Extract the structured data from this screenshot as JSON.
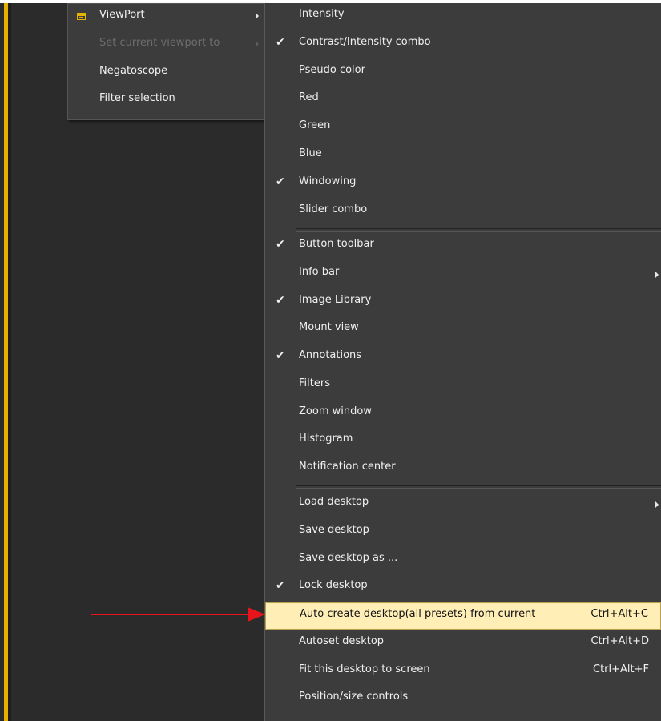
{
  "main_menu": {
    "items": [
      {
        "label": "ViewPort",
        "icon": "viewport-icon",
        "has_submenu": true,
        "disabled": false
      },
      {
        "label": "Set current viewport to",
        "has_submenu": true,
        "disabled": true
      },
      {
        "label": "Negatoscope",
        "disabled": false
      },
      {
        "label": "Filter selection",
        "disabled": false
      }
    ]
  },
  "submenu": {
    "items": [
      {
        "label": "Intensity",
        "checked": false
      },
      {
        "label": "Contrast/Intensity combo",
        "checked": true
      },
      {
        "label": "Pseudo color",
        "checked": false
      },
      {
        "label": "Red",
        "checked": false
      },
      {
        "label": "Green",
        "checked": false
      },
      {
        "label": "Blue",
        "checked": false
      },
      {
        "label": "Windowing",
        "checked": true
      },
      {
        "label": "Slider combo",
        "checked": false
      },
      {
        "label": "Button toolbar",
        "checked": true
      },
      {
        "label": "Info bar",
        "checked": false,
        "has_submenu": true
      },
      {
        "label": "Image Library",
        "checked": true
      },
      {
        "label": "Mount view",
        "checked": false
      },
      {
        "label": "Annotations",
        "checked": true
      },
      {
        "label": "Filters",
        "checked": false
      },
      {
        "label": "Zoom window",
        "checked": false
      },
      {
        "label": "Histogram",
        "checked": false
      },
      {
        "label": "Notification center",
        "checked": false
      },
      {
        "label": "Load desktop",
        "checked": false,
        "has_submenu": true
      },
      {
        "label": "Save desktop",
        "checked": false
      },
      {
        "label": "Save desktop as ...",
        "checked": false
      },
      {
        "label": "Lock desktop",
        "checked": true
      },
      {
        "label": "Auto create desktop(all presets) from current",
        "shortcut": "Ctrl+Alt+C",
        "highlighted": true
      },
      {
        "label": "Autoset desktop",
        "shortcut": "Ctrl+Alt+D"
      },
      {
        "label": "Fit this desktop to screen",
        "shortcut": "Ctrl+Alt+F"
      },
      {
        "label": "Position/size controls"
      }
    ],
    "check_glyph": "✔"
  },
  "colors": {
    "menu_bg": "#3c3c3c",
    "highlight_bg": "#ffeeb6",
    "accent_yellow": "#e6b000",
    "arrow_red": "#e8141c"
  }
}
